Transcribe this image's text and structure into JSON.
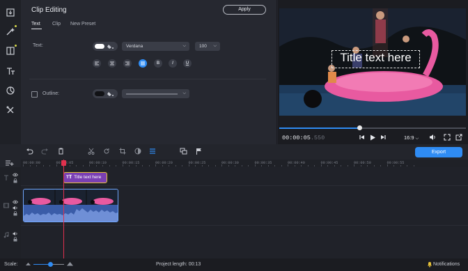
{
  "panel": {
    "title": "Clip Editing",
    "apply_label": "Apply",
    "tabs": [
      {
        "label": "Text",
        "active": true
      },
      {
        "label": "Clip",
        "active": false
      },
      {
        "label": "New Preset",
        "active": false
      }
    ],
    "text_label": "Text:",
    "font_name": "Verdana",
    "font_size": "100",
    "alignment_buttons": [
      "align-left",
      "align-center",
      "align-right",
      "justify"
    ],
    "style_buttons": [
      "B",
      "I",
      "U"
    ],
    "outline_label": "Outline:",
    "outline_checked": false
  },
  "preview": {
    "title_overlay": "Title text here",
    "timecode_main": "00:00:05",
    "timecode_ms": ".550",
    "progress": 0.43,
    "aspect_ratio": "16:9"
  },
  "timeline": {
    "export_label": "Export",
    "ruler_labels": [
      "00:00:00",
      "00:00:05",
      "00:00:10",
      "00:00:15",
      "00:00:20",
      "00:00:25",
      "00:00:30",
      "00:00:35",
      "00:00:40",
      "00:00:45",
      "00:00:50",
      "00:00:55"
    ],
    "title_clip_label": "Title text here"
  },
  "status": {
    "scale_label": "Scale:",
    "scale_value": 0.55,
    "project_length": "Project length:  00:13",
    "notifications_label": "Notifications"
  },
  "colors": {
    "accent": "#2f8cf4",
    "playhead": "#e0314e",
    "title_clip": "#7a3fb3",
    "clip_border_selected": "#e7c238"
  }
}
